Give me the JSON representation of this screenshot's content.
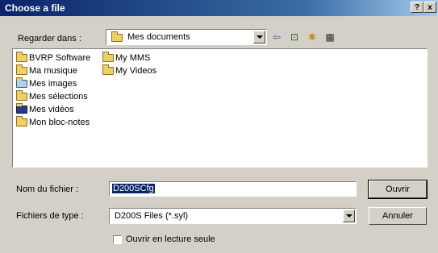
{
  "window": {
    "title": "Choose a file",
    "help_label": "?",
    "close_label": "x"
  },
  "lookin": {
    "label": "Regarder dans :",
    "value": "Mes documents"
  },
  "toolbar": {
    "back_glyph": "⇦",
    "up_glyph": "⊡",
    "newfolder_glyph": "✱",
    "view_glyph": "▦"
  },
  "files": [
    {
      "name": "BVRP Software",
      "icon": "folder-icon"
    },
    {
      "name": "Ma musique",
      "icon": "music-folder-icon"
    },
    {
      "name": "Mes images",
      "icon": "pictures-folder-icon"
    },
    {
      "name": "Mes sélections",
      "icon": "folder-icon"
    },
    {
      "name": "Mes vidéos",
      "icon": "video-folder-icon"
    },
    {
      "name": "Mon bloc-notes",
      "icon": "folder-icon"
    },
    {
      "name": "My MMS",
      "icon": "folder-icon"
    },
    {
      "name": "My Videos",
      "icon": "folder-icon"
    }
  ],
  "filename": {
    "label": "Nom du fichier :",
    "value": "D200SCfg"
  },
  "filetype": {
    "label": "Fichiers de type :",
    "value": "D200S Files (*.syl)"
  },
  "buttons": {
    "open": "Ouvrir",
    "cancel": "Annuler"
  },
  "readonly": {
    "label": "Ouvrir en lecture seule",
    "checked": false
  },
  "colors": {
    "titlebar": "#0a246a",
    "face": "#d4d0c8",
    "selection": "#0a246a"
  }
}
